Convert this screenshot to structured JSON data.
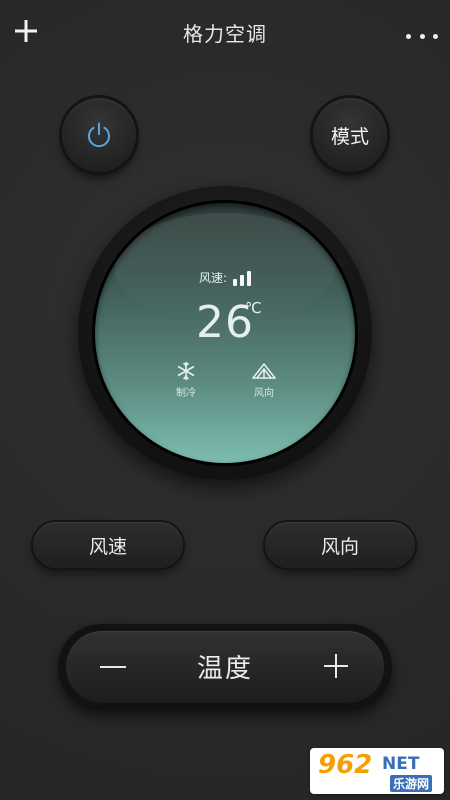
{
  "header": {
    "title": "格力空调",
    "add_icon": "plus-icon",
    "more_icon": "more-dots-icon"
  },
  "controls": {
    "power_icon": "power-icon",
    "power_icon_color": "#5aa6d6",
    "mode_label": "模式"
  },
  "display": {
    "fan_speed_label": "风速:",
    "fan_speed_level": 3,
    "fan_speed_icon": "signal-bars-icon",
    "temperature": "26",
    "unit": "℃",
    "mode_icon": "snowflake-icon",
    "mode_caption": "制冷",
    "direction_icon": "wind-direction-icon",
    "direction_caption": "风向"
  },
  "buttons": {
    "fan_speed_label": "风速",
    "direction_label": "风向"
  },
  "temperature_bar": {
    "label": "温度",
    "minus_icon": "minus-icon",
    "plus_icon": "plus-icon"
  },
  "watermark": {
    "number": "962",
    "net": "NET",
    "sub": "乐游网"
  },
  "colors": {
    "background": "#2b2b2b",
    "display_top": "#2d3a38",
    "display_bottom": "#7dbdb0"
  }
}
